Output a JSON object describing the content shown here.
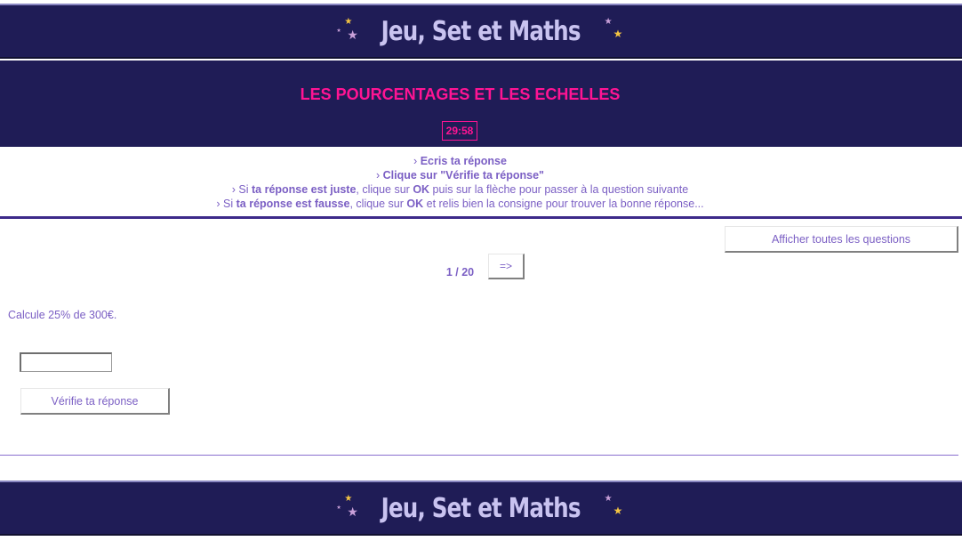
{
  "site": {
    "logo_text": "Jeu, Set et Maths",
    "colors": {
      "banner": "#1f1c56",
      "title": "#ff1493",
      "text": "#7b5fc4",
      "star_gold": "#f5c542",
      "star_pink": "#c9a0d9"
    }
  },
  "header": {
    "title": "LES POURCENTAGES ET LES ECHELLES",
    "timer": "29:58"
  },
  "instructions": {
    "bullet": "›",
    "line1": "Ecris ta réponse",
    "line2": "Clique sur \"Vérifie ta réponse\"",
    "line3_a": "Si ",
    "line3_b": "ta réponse est juste",
    "line3_c": ", clique sur ",
    "line3_d": "OK",
    "line3_e": " puis sur la flèche pour passer à la question suivante",
    "line4_a": "Si ",
    "line4_b": "ta réponse est fausse",
    "line4_c": ", clique sur ",
    "line4_d": "OK",
    "line4_e": " et relis bien la consigne pour trouver la bonne réponse..."
  },
  "navigation": {
    "show_all_label": "Afficher toutes les questions",
    "counter": "1 / 20",
    "next_label": "=>"
  },
  "question": {
    "text": "Calcule 25% de 300€.",
    "answer_value": "",
    "verify_label": "Vérifie ta réponse"
  }
}
